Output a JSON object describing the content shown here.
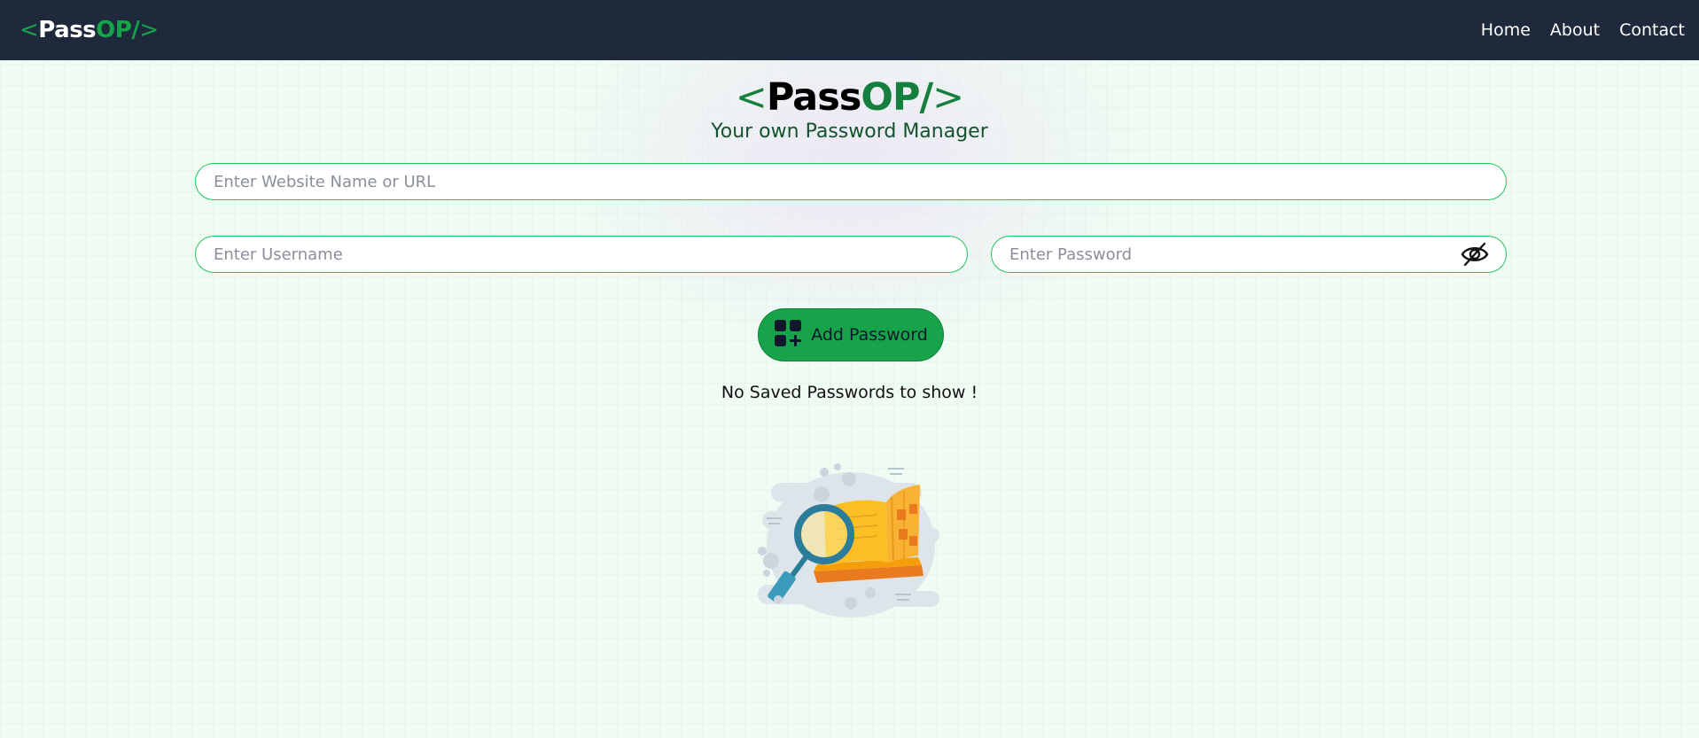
{
  "navbar": {
    "logo": {
      "open": "<",
      "pass": "Pass",
      "op": "OP/",
      "close": ">"
    },
    "links": [
      {
        "label": "Home"
      },
      {
        "label": "About"
      },
      {
        "label": "Contact"
      }
    ]
  },
  "hero": {
    "logo": {
      "open": "<",
      "pass": "Pass",
      "op": "OP/",
      "close": ">"
    },
    "tagline": "Your own Password Manager"
  },
  "form": {
    "site_placeholder": "Enter Website Name or URL",
    "site_value": "",
    "username_placeholder": "Enter Username",
    "username_value": "",
    "password_placeholder": "Enter Password",
    "password_value": "",
    "toggle_icon": "eye-off-icon",
    "add_button_icon": "add-grid-icon",
    "add_button_label": "Add Password"
  },
  "empty_state": {
    "message": "No Saved Passwords to show !",
    "illustration": "magnifier-book-illustration"
  },
  "colors": {
    "navbar_bg": "#1e293b",
    "accent_green": "#16a34a",
    "dark_green": "#15803d",
    "page_bg": "#effcf3"
  }
}
